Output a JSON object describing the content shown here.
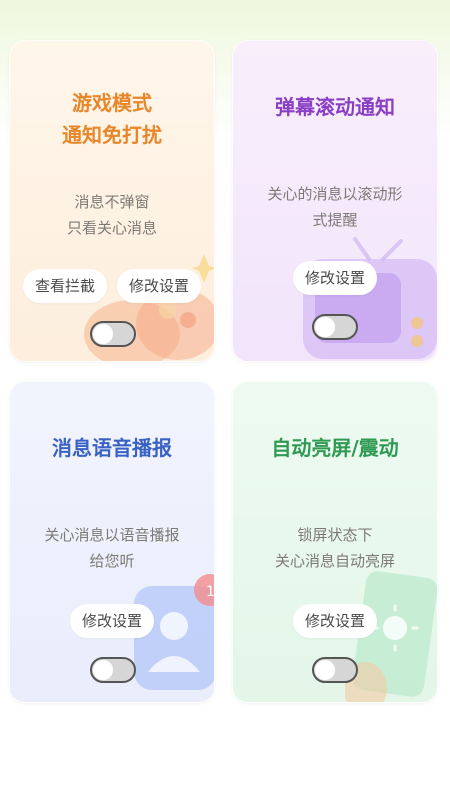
{
  "cards": [
    {
      "title": [
        "游戏模式",
        "通知免打扰"
      ],
      "title_color": "#e8862a",
      "description": [
        "消息不弹窗",
        "只看关心消息"
      ],
      "buttons": [
        "查看拦截",
        "修改设置"
      ],
      "toggle_on": false,
      "icon": "gamepad-icon"
    },
    {
      "title": [
        "弹幕滚动通知"
      ],
      "title_color": "#8a3ec6",
      "description": [
        "关心的消息以滚动形",
        "式提醒"
      ],
      "buttons": [
        "修改设置"
      ],
      "toggle_on": false,
      "icon": "tv-icon"
    },
    {
      "title": [
        "消息语音播报"
      ],
      "title_color": "#3a62c4",
      "description": [
        "关心消息以语音播报",
        "给您听"
      ],
      "buttons": [
        "修改设置"
      ],
      "toggle_on": false,
      "icon": "user-chat-icon"
    },
    {
      "title": [
        "自动亮屏/震动"
      ],
      "title_color": "#2f9a52",
      "description": [
        "锁屏状态下",
        "关心消息自动亮屏"
      ],
      "buttons": [
        "修改设置"
      ],
      "toggle_on": false,
      "icon": "phone-screen-icon"
    }
  ]
}
